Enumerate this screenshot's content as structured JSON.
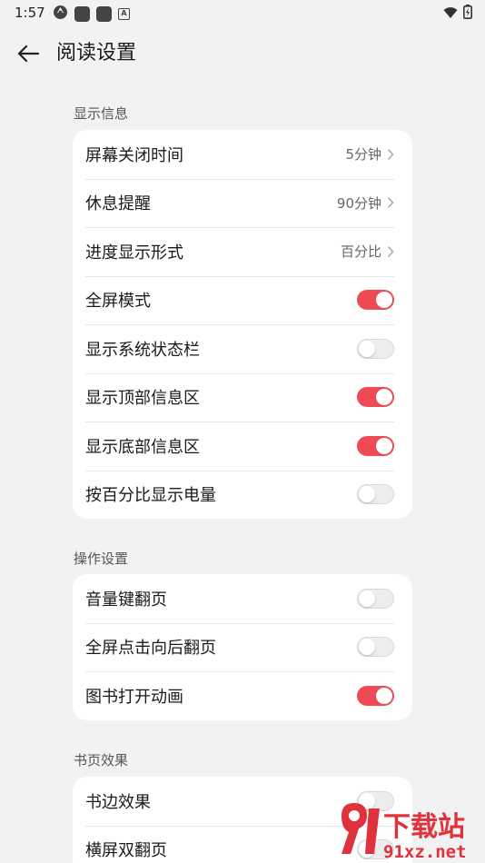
{
  "status_bar": {
    "time": "1:57",
    "small_icon_letter": "A"
  },
  "header": {
    "title": "阅读设置"
  },
  "sections": [
    {
      "title": "显示信息",
      "rows": [
        {
          "label": "屏幕关闭时间",
          "value": "5分钟"
        },
        {
          "label": "休息提醒",
          "value": "90分钟"
        },
        {
          "label": "进度显示形式",
          "value": "百分比"
        },
        {
          "label": "全屏模式",
          "toggle": true
        },
        {
          "label": "显示系统状态栏",
          "toggle": false
        },
        {
          "label": "显示顶部信息区",
          "toggle": true
        },
        {
          "label": "显示底部信息区",
          "toggle": true
        },
        {
          "label": "按百分比显示电量",
          "toggle": false
        }
      ]
    },
    {
      "title": "操作设置",
      "rows": [
        {
          "label": "音量键翻页",
          "toggle": false
        },
        {
          "label": "全屏点击向后翻页",
          "toggle": false
        },
        {
          "label": "图书打开动画",
          "toggle": true
        }
      ]
    },
    {
      "title": "书页效果",
      "rows": [
        {
          "label": "书边效果",
          "toggle": false
        },
        {
          "label": "横屏双翻页",
          "toggle": false
        }
      ]
    }
  ],
  "watermark": {
    "text_top": "下载站",
    "text_bottom": "91xz.net"
  },
  "colors": {
    "accent": "#ef4b57",
    "background": "#f2f2f4",
    "card": "#ffffff"
  }
}
